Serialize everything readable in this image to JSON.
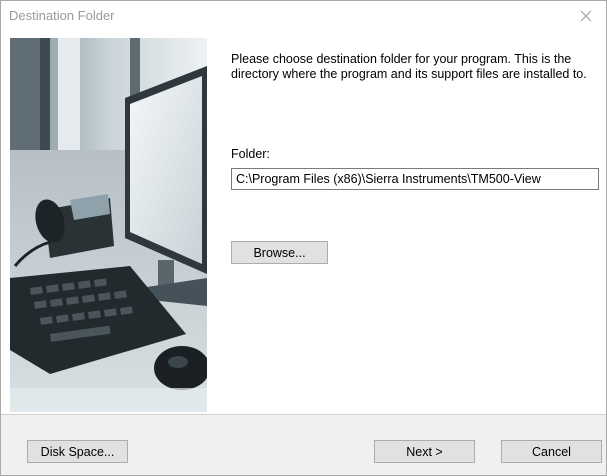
{
  "window": {
    "title": "Destination Folder",
    "close_icon": "close-icon"
  },
  "main": {
    "intro_text": "Please choose destination folder for your program. This is the directory where the program and its support files are installed to.",
    "folder_label": "Folder:",
    "folder_value": "C:\\Program Files (x86)\\Sierra Instruments\\TM500-View",
    "browse_label": "Browse..."
  },
  "footer": {
    "disk_space_label": "Disk Space...",
    "next_label": "Next >",
    "cancel_label": "Cancel"
  }
}
